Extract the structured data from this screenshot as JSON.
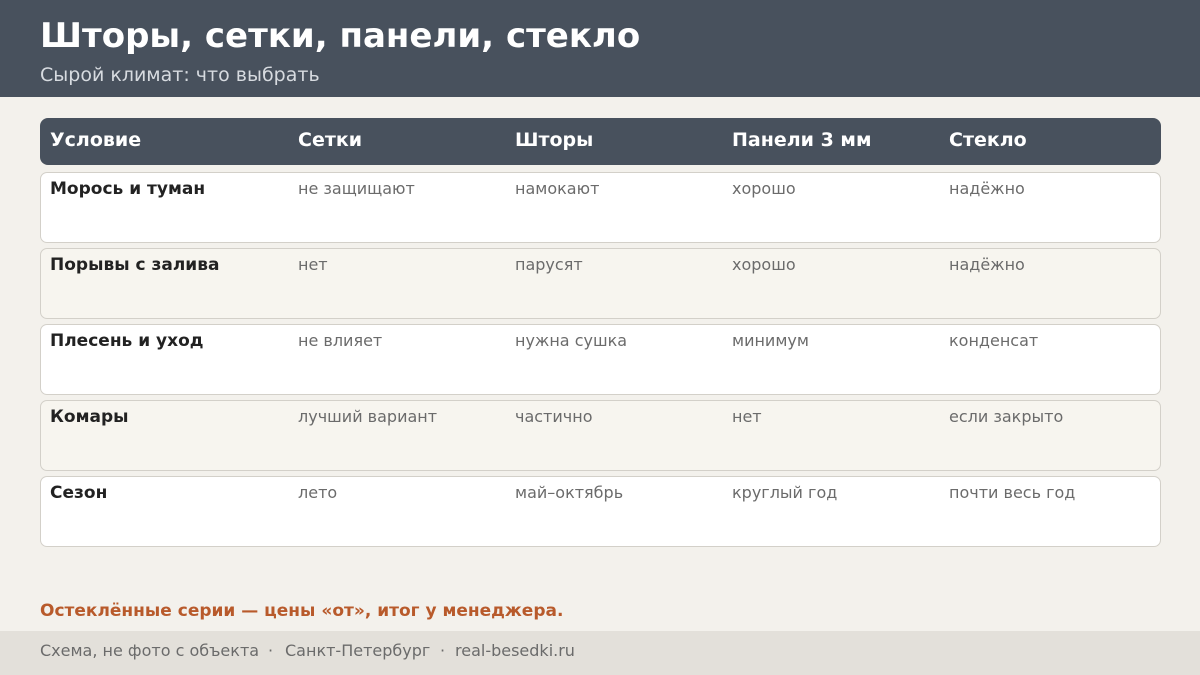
{
  "header": {
    "title": "Шторы, сетки, панели, стекло",
    "subtitle": "Сырой климат: что выбрать"
  },
  "table": {
    "columns": [
      "Условие",
      "Сетки",
      "Шторы",
      "Панели 3 мм",
      "Стекло"
    ],
    "rows": [
      [
        "Морось и туман",
        "не защищают",
        "намокают",
        "хорошо",
        "надёжно"
      ],
      [
        "Порывы с залива",
        "нет",
        "парусят",
        "хорошо",
        "надёжно"
      ],
      [
        "Плесень и уход",
        "не влияет",
        "нужна сушка",
        "минимум",
        "конденсат"
      ],
      [
        "Комары",
        "лучший вариант",
        "частично",
        "нет",
        "если закрыто"
      ],
      [
        "Сезон",
        "лето",
        "май–октябрь",
        "круглый год",
        "почти весь год"
      ]
    ]
  },
  "note": "Остеклённые серии — цены «от», итог у менеджера.",
  "footer": {
    "disclaimer": "Схема, не фото с объекта",
    "sep1": "·",
    "city": "Санкт-Петербург",
    "sep2": "·",
    "site": "real-besedki.ru"
  },
  "colors": {
    "header_bg": "#48515d",
    "accent": "#b85a2b",
    "page_bg": "#f3f1ec"
  }
}
